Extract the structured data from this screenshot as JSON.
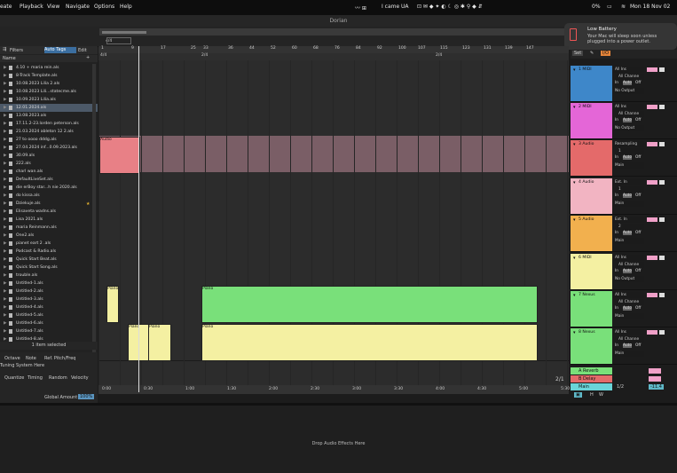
{
  "menubar": {
    "items": [
      "eate",
      "Playback",
      "View",
      "Navigate",
      "Options",
      "Help"
    ],
    "status": {
      "user": "I came",
      "input": "UA",
      "battery": "0%",
      "datetime": "Mon 18 Nov 02"
    }
  },
  "window": {
    "title": "Dorian"
  },
  "notification": {
    "title": "Low Battery",
    "body": "Your Mac will sleep soon unless plugged into a power outlet."
  },
  "browser": {
    "filters": "Filters",
    "auto_tags": "Auto Tags",
    "edit": "Edit",
    "column": "Name",
    "items": [
      "4.10 + maria rein.als",
      "8-Track Template.als",
      "10.08.2023 Lilia 2.als",
      "10.08.2023 Lili...statecme.als",
      "10.09.2023 Lilia.als",
      "12.01.2024.als",
      "13.08.2023.als",
      "17.11.2-23.lorden peterson.als",
      "21.03.2024 ableton 12 2.als",
      "27 to oooo dddg.als",
      "27.04.2024 inf...0.09.2023.als",
      "30.09.als",
      "222.als",
      "charl wan.als",
      "DefaultLiveSet.als",
      "die erBoy star...h nie 2020.als",
      "do kissa.als",
      "Dziekuje.als",
      "Elisaveta wadns.als",
      "Lisa 2021.als",
      "maria Reinmann.als",
      "One2.als",
      "pianet eart 2 .als",
      "Podcast & Radio.als",
      "Quick Start Beat.als",
      "Quick Start Song.als",
      "trouble.als",
      "Untitled-1.als",
      "Untitled-2.als",
      "Untitled-3.als",
      "Untitled-4.als",
      "Untitled-5.als",
      "Untitled-6.als",
      "Untitled-7.als",
      "Untitled-8.als"
    ],
    "selected_index": 5,
    "status": "1 item selected"
  },
  "groove": {
    "tabs": [
      "Octave",
      "Note",
      "Ref. Pitch/Freq"
    ],
    "tuning": "Tuning System Here",
    "tabs2": [
      "Quantize",
      "Timing",
      "Random",
      "Velocity"
    ],
    "global_amount": "Global Amount",
    "global_value": "100%"
  },
  "ruler": {
    "bars": [
      "1",
      "9",
      "17",
      "25",
      "33",
      "36",
      "44",
      "52",
      "60",
      "68",
      "76",
      "84",
      "92",
      "100",
      "107",
      "115",
      "123",
      "131",
      "139",
      "147"
    ],
    "times": [
      "0:00",
      "0:30",
      "1:00",
      "1:30",
      "2:00",
      "2:30",
      "3:00",
      "3:30",
      "4:00",
      "4:30",
      "5:00",
      "5:30"
    ],
    "sig": "4/4",
    "sig2": "2/4",
    "zoom": "2/1"
  },
  "clips": {
    "audio": "Audio",
    "piano": "Piano"
  },
  "tracks": [
    {
      "name": "1 MIDI",
      "color": "#3e87c9",
      "input": "All Ins",
      "channel": "All Channe",
      "monitor": [
        "In",
        "Auto",
        "Off"
      ],
      "output": "No Output"
    },
    {
      "name": "2 MIDI",
      "color": "#e466d7",
      "input": "All Ins",
      "channel": "All Channe",
      "monitor": [
        "In",
        "Auto",
        "Off"
      ],
      "output": "No Output"
    },
    {
      "name": "3 Audio",
      "color": "#e46a6a",
      "input": "Resampling",
      "channel": "1",
      "monitor": [
        "In",
        "Auto",
        "Off"
      ],
      "output": "Main"
    },
    {
      "name": "4 Audio",
      "color": "#f2b4c2",
      "input": "Ext. In",
      "channel": "1",
      "monitor": [
        "In",
        "Auto",
        "Off"
      ],
      "output": "Main"
    },
    {
      "name": "5 Audio",
      "color": "#f2b04e",
      "input": "Ext. In",
      "channel": "2",
      "monitor": [
        "In",
        "Auto",
        "Off"
      ],
      "output": "Main"
    },
    {
      "name": "6 MIDI",
      "color": "#f4f0a2",
      "input": "All Ins",
      "channel": "All Channe",
      "monitor": [
        "In",
        "Auto",
        "Off"
      ],
      "output": "No Output"
    },
    {
      "name": "7 Nexus",
      "color": "#79e07a",
      "input": "All Ins",
      "channel": "All Channe",
      "monitor": [
        "In",
        "Auto",
        "Off"
      ],
      "output": "Main"
    },
    {
      "name": "8 Nexus",
      "color": "#79e07a",
      "input": "All Ins",
      "channel": "All Channe",
      "monitor": [
        "In",
        "Auto",
        "Off"
      ],
      "output": "Main"
    }
  ],
  "returns": [
    {
      "name": "A Reverb",
      "color": "#79e07a"
    },
    {
      "name": "B Delay",
      "color": "#e46a6a"
    }
  ],
  "master": {
    "name": "Main",
    "color": "#6ad4d8",
    "ratio": "1/2",
    "value": "-11.4"
  },
  "mixer": {
    "set": "Set",
    "io": "I/O"
  },
  "bottom": {
    "drop": "Drop Audio Effects Here"
  }
}
